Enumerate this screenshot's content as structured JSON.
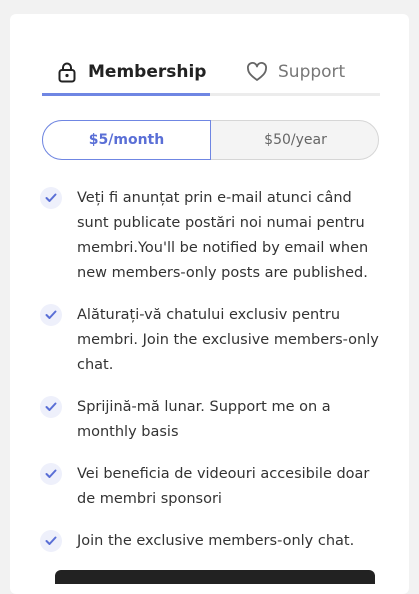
{
  "tabs": {
    "membership": {
      "label": "Membership",
      "icon": "lock-icon",
      "active": true
    },
    "support": {
      "label": "Support",
      "icon": "heart-icon",
      "active": false
    }
  },
  "billing": {
    "monthly_label": "$5/month",
    "yearly_label": "$50/year",
    "selected": "monthly"
  },
  "benefits": [
    "Veți fi anunțat prin e-mail atunci când sunt publicate postări noi numai pentru membri.You'll be notified by email when new members-only posts are published.",
    "Alăturați-vă chatului exclusiv pentru membri. Join the exclusive members-only chat.",
    "Sprijină-mă lunar. Support me on a monthly basis",
    "Vei beneficia de videouri accesibile doar de membri sponsori",
    "Join the exclusive members-only chat."
  ],
  "colors": {
    "accent": "#6f86e3",
    "check_bg": "#eef0fb"
  }
}
